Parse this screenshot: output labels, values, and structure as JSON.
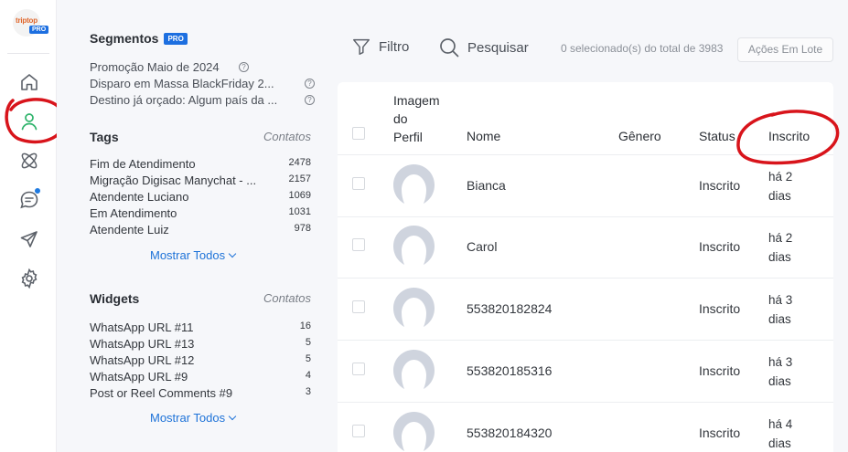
{
  "brand": {
    "logo_text": "triptop",
    "badge": "PRO"
  },
  "rail": {
    "items": [
      {
        "name": "home-icon",
        "active": false
      },
      {
        "name": "user-icon",
        "active": true
      },
      {
        "name": "atom-icon",
        "active": false
      },
      {
        "name": "chat-icon",
        "active": false,
        "dot": true
      },
      {
        "name": "send-icon",
        "active": false
      },
      {
        "name": "gear-icon",
        "active": false
      }
    ]
  },
  "panel": {
    "segments": {
      "title": "Segmentos",
      "badge": "PRO",
      "items": [
        {
          "label": "Promoção Maio de 2024"
        },
        {
          "label": "Disparo em Massa BlackFriday 2..."
        },
        {
          "label": "Destino já orçado: Algum país da ..."
        }
      ]
    },
    "tags": {
      "title": "Tags",
      "count_header": "Contatos",
      "items": [
        {
          "label": "Fim de Atendimento",
          "count": "2478"
        },
        {
          "label": "Migração Digisac Manychat - ...",
          "count": "2157"
        },
        {
          "label": "Atendente Luciano",
          "count": "1069"
        },
        {
          "label": "Em Atendimento",
          "count": "1031"
        },
        {
          "label": "Atendente Luiz",
          "count": "978"
        }
      ],
      "show_all": "Mostrar Todos"
    },
    "widgets": {
      "title": "Widgets",
      "count_header": "Contatos",
      "items": [
        {
          "label": "WhatsApp URL #11",
          "count": "16"
        },
        {
          "label": "WhatsApp URL #13",
          "count": "5"
        },
        {
          "label": "WhatsApp URL #12",
          "count": "5"
        },
        {
          "label": "WhatsApp URL #9",
          "count": "4"
        },
        {
          "label": "Post or Reel Comments #9",
          "count": "3"
        }
      ],
      "show_all": "Mostrar Todos"
    }
  },
  "toolbar": {
    "filter_label": "Filtro",
    "search_label": "Pesquisar",
    "selection_text": "0 selecionado(s) do total de 3983",
    "bulk_actions": "Ações Em Lote"
  },
  "table": {
    "columns": {
      "image_line1": "Imagem",
      "image_line2": "do",
      "image_line3": "Perfil",
      "name": "Nome",
      "gender": "Gênero",
      "status": "Status",
      "subscribed": "Inscrito"
    },
    "rows": [
      {
        "name": "Bianca",
        "gender": "",
        "status": "Inscrito",
        "time_line1": "há 2",
        "time_line2": "dias"
      },
      {
        "name": "Carol",
        "gender": "",
        "status": "Inscrito",
        "time_line1": "há 2",
        "time_line2": "dias"
      },
      {
        "name": "553820182824",
        "gender": "",
        "status": "Inscrito",
        "time_line1": "há 3",
        "time_line2": "dias"
      },
      {
        "name": "553820185316",
        "gender": "",
        "status": "Inscrito",
        "time_line1": "há 3",
        "time_line2": "dias"
      },
      {
        "name": "553820184320",
        "gender": "",
        "status": "Inscrito",
        "time_line1": "há 4",
        "time_line2": "dias"
      }
    ]
  },
  "colors": {
    "accent": "#1d72d8",
    "active_icon": "#2fb36b",
    "annotation": "#d8141b",
    "badge": "#1d6fe0"
  }
}
